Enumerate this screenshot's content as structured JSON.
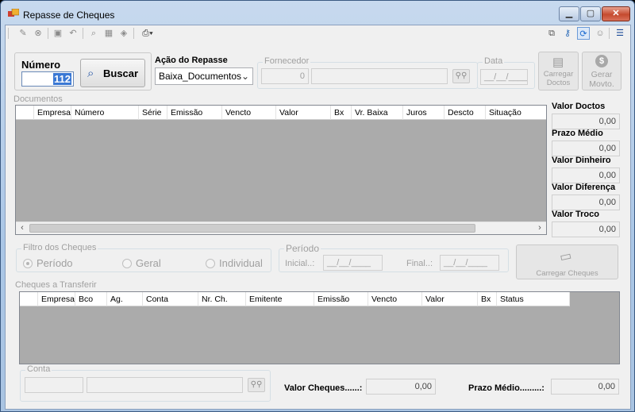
{
  "window": {
    "title": "Repasse de Cheques",
    "controls": {
      "minimize": "▁",
      "maximize": "▢",
      "close": "✕"
    }
  },
  "toolbar": {
    "left_icons": [
      "edit-icon",
      "cancel-icon",
      "save-icon",
      "undo-icon",
      "zoom-icon",
      "grid-icon",
      "eraser-icon",
      "print-icon"
    ],
    "right_icons": [
      "windows-icon",
      "keys-icon",
      "refresh-icon",
      "user-icon",
      "menu-icon"
    ]
  },
  "header": {
    "numero_label": "Número",
    "numero_value": "112",
    "buscar_label": "Buscar",
    "acao_label": "Ação do Repasse",
    "acao_value": "Baixa_Documentos",
    "fornecedor_label": "Fornecedor",
    "fornecedor_code": "0",
    "fornecedor_name": "",
    "data_label": "Data",
    "data_value": "__/__/____",
    "carregar_doctos_label_1": "Carregar",
    "carregar_doctos_label_2": "Doctos",
    "gerar_movto_label_1": "Gerar",
    "gerar_movto_label_2": "Movto."
  },
  "documentos": {
    "title": "Documentos",
    "columns": [
      "Empresa",
      "Número",
      "Série",
      "Emissão",
      "Vencto",
      "Valor",
      "Bx",
      "Vr. Baixa",
      "Juros",
      "Descto",
      "Situação"
    ]
  },
  "summary": {
    "valor_doctos_label": "Valor Doctos",
    "valor_doctos": "0,00",
    "prazo_medio_label": "Prazo Médio",
    "prazo_medio": "0,00",
    "valor_dinheiro_label": "Valor Dinheiro",
    "valor_dinheiro": "0,00",
    "valor_diferenca_label": "Valor Diferença",
    "valor_diferenca": "0,00",
    "valor_troco_label": "Valor Troco",
    "valor_troco": "0,00"
  },
  "filtro": {
    "title": "Filtro dos Cheques",
    "opt_periodo": "Período",
    "opt_geral": "Geral",
    "opt_individual": "Individual",
    "selected": "Período"
  },
  "periodo": {
    "title": "Período",
    "inicial_label": "Inicial..:",
    "inicial_value": "__/__/____",
    "final_label": "Final..:",
    "final_value": "__/__/____"
  },
  "carregar_cheques_label": "Carregar Cheques",
  "cheques": {
    "title": "Cheques a Transferir",
    "columns": [
      "Empresa",
      "Bco",
      "Ag.",
      "Conta",
      "Nr. Ch.",
      "Emitente",
      "Emissão",
      "Vencto",
      "Valor",
      "Bx",
      "Status"
    ]
  },
  "conta": {
    "title": "Conta"
  },
  "footer": {
    "valor_cheques_label": "Valor Cheques......:",
    "valor_cheques": "0,00",
    "prazo_medio_label": "Prazo Médio.........:",
    "prazo_medio": "0,00"
  }
}
